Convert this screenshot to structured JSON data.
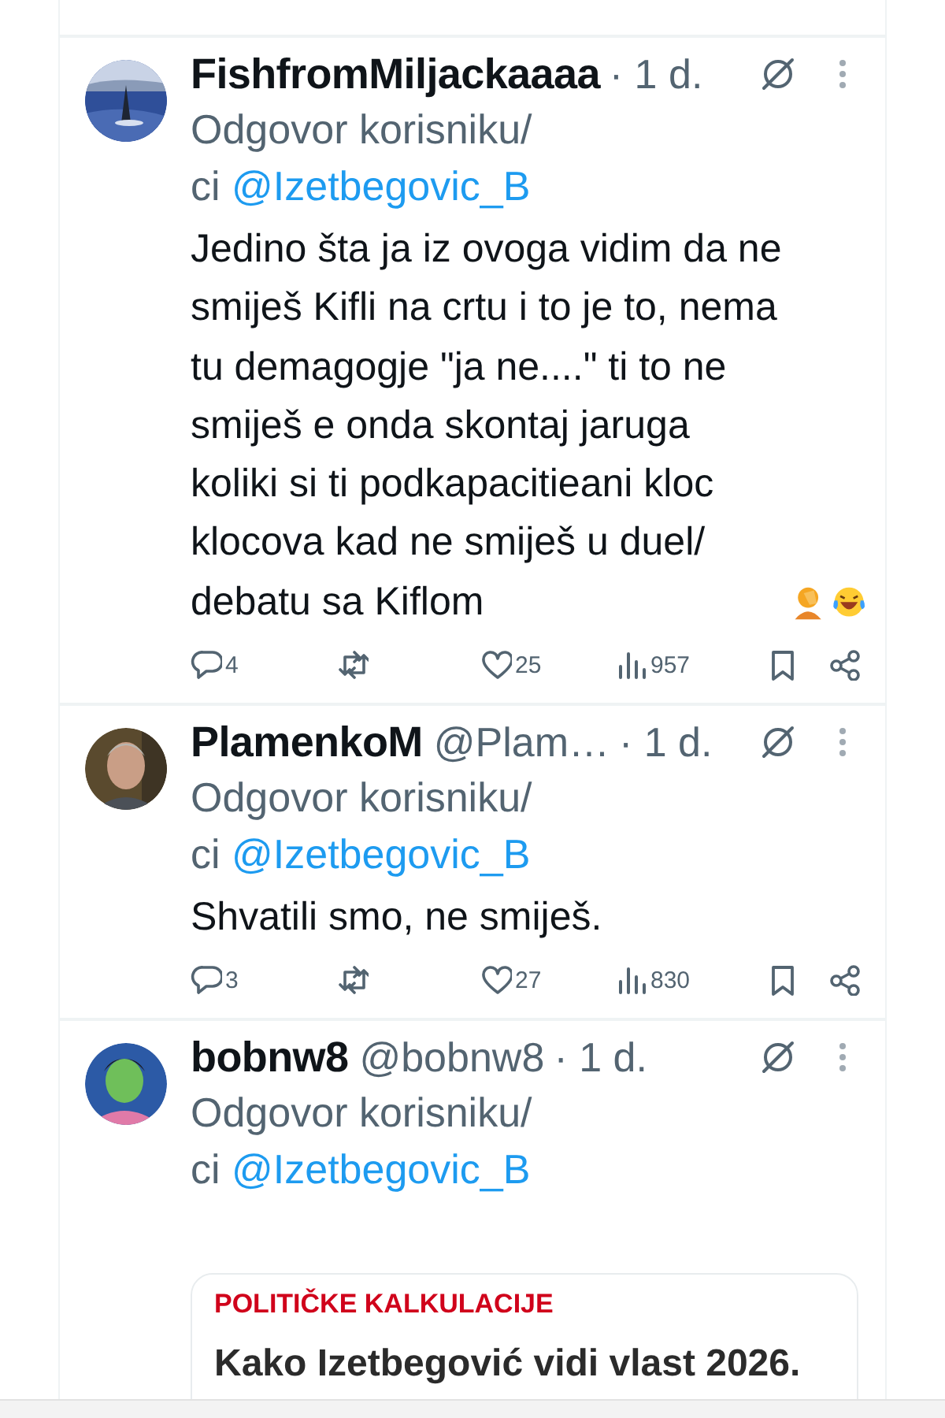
{
  "tweets": [
    {
      "avatar": {
        "kind": "picture"
      },
      "name": "FishfromMiljackaaaa",
      "time": "· 1 d.",
      "reply_to": "Odgovor korisniku/ci",
      "reply_handle": "@Izetbegovic_B",
      "text": "Jedino šta ja iz ovoga vidim da ne smiješ Kifli na crtu i to je to, nema tu demagogje \"ja ne....\" ti to ne smiješ e onda skontaj jaruga koliki si ti podkapacitieani kloc klocova kad ne smiješ u duel/ debatu sa Kiflom",
      "emoji": [
        {
          "kind": "facepalm"
        },
        {
          "kind": "laugh"
        }
      ],
      "replies": "4",
      "likes": "25",
      "views": "957"
    },
    {
      "avatar": {
        "kind": "picture"
      },
      "name": "PlamenkoM",
      "handle": "@Plam…",
      "time": "· 1 d.",
      "reply_to": "Odgovor korisniku/ci",
      "reply_handle": "@Izetbegovic_B",
      "text": "Shvatili smo, ne smiješ.",
      "replies": "3",
      "likes": "27",
      "views": "830"
    },
    {
      "avatar": {
        "kind": "picture"
      },
      "name": "bobnw8",
      "handle": "@bobnw8",
      "time": "· 1 d.",
      "reply_to": "Odgovor korisniku/ci",
      "reply_handle": "@Izetbegovic_B",
      "card": {
        "kicker": "POLITIČKE KALKULACIJE",
        "title": "Kako Izetbegović vidi vlast 2026."
      }
    }
  ]
}
